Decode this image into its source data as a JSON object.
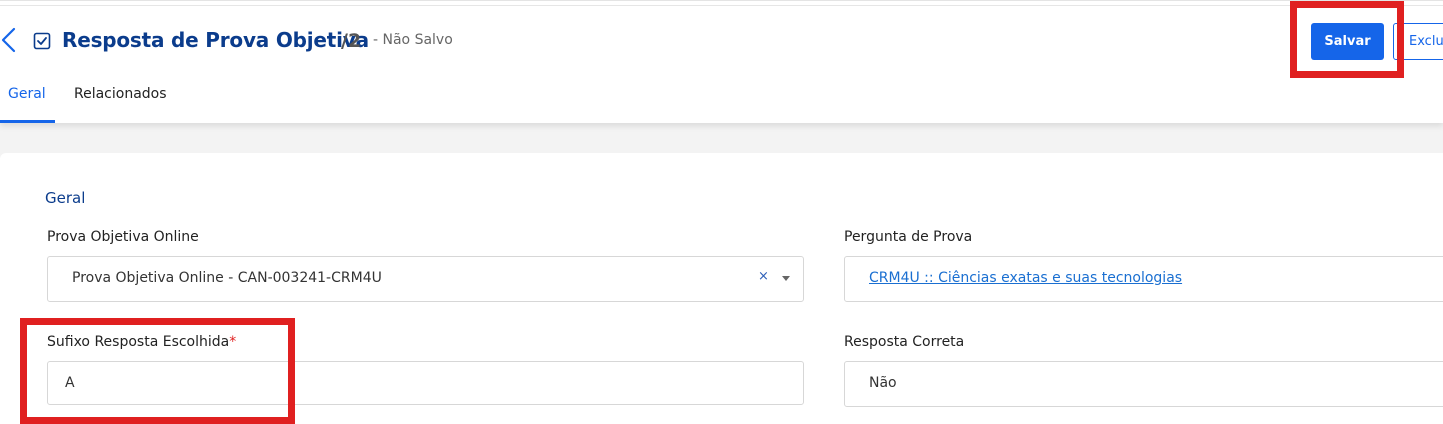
{
  "header": {
    "title": "Resposta de Prova Objetiva",
    "record_number": "/2",
    "status": "- Não Salvo",
    "save_label": "Salvar",
    "delete_label": "Exclu"
  },
  "tabs": [
    {
      "label": "Geral",
      "active": true
    },
    {
      "label": "Relacionados",
      "active": false
    }
  ],
  "form": {
    "section_title": "Geral",
    "fields": {
      "prova_objetiva": {
        "label": "Prova Objetiva Online",
        "value": "Prova Objetiva Online - CAN-003241-CRM4U",
        "clear_glyph": "×"
      },
      "pergunta": {
        "label": "Pergunta de Prova",
        "value": "CRM4U :: Ciências exatas e suas tecnologias"
      },
      "sufixo": {
        "label": "Sufixo Resposta Escolhida",
        "required_marker": "*",
        "value": "A"
      },
      "resposta_correta": {
        "label": "Resposta Correta",
        "value": "Não"
      }
    }
  },
  "colors": {
    "primary": "#1565e9",
    "title": "#0b3c8c",
    "highlight": "#e02020",
    "link": "#1a6fd1"
  },
  "icons": {
    "back": "chevron-left-icon",
    "record": "checkbox-icon",
    "dropdown": "caret-down-icon"
  }
}
